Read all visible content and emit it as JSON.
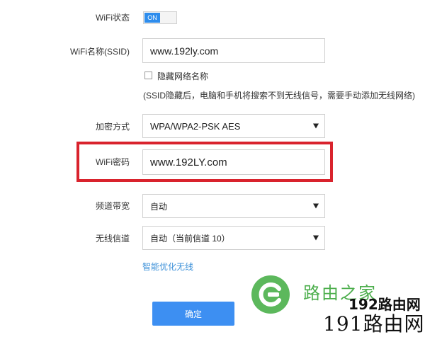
{
  "form": {
    "wifi_status": {
      "label": "WiFi状态",
      "toggle_text": "ON"
    },
    "ssid": {
      "label": "WiFi名称(SSID)",
      "value": "www.192ly.com"
    },
    "hide_ssid": {
      "label": "隐藏网络名称",
      "hint": "(SSID隐藏后，电脑和手机将搜索不到无线信号，需要手动添加无线网络)"
    },
    "encryption": {
      "label": "加密方式",
      "value": "WPA/WPA2-PSK AES"
    },
    "password": {
      "label": "WiFi密码",
      "value": "www.192LY.com"
    },
    "bandwidth": {
      "label": "频道带宽",
      "value": "自动"
    },
    "channel": {
      "label": "无线信道",
      "value": "自动（当前信道 10）"
    },
    "optimize_link": "智能优化无线",
    "submit": "确定"
  },
  "watermark": {
    "brand_cn": "路由之家",
    "site_192": "192路由网",
    "site_191": "191路由网"
  },
  "colors": {
    "accent": "#3d8ff2",
    "highlight_frame": "#d9232d",
    "toggle_on": "#2e8ded",
    "watermark_green": "#4cae4c"
  }
}
